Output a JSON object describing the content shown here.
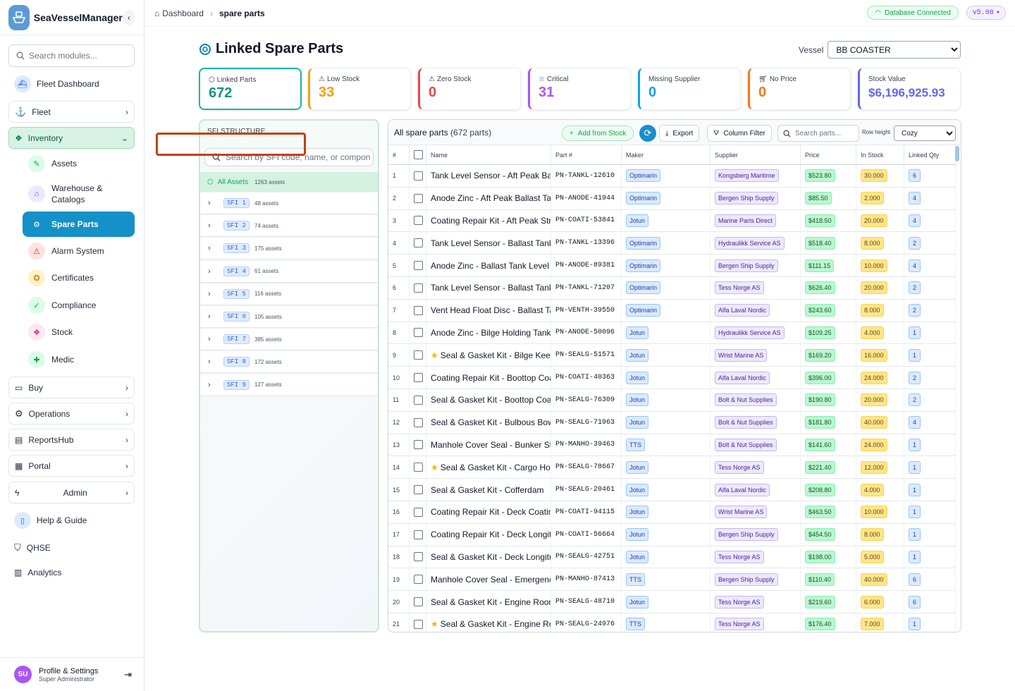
{
  "app": {
    "name": "SeaVesselManager"
  },
  "sidebar": {
    "search_placeholder": "Search modules...",
    "fleet_dashboard": "Fleet Dashboard",
    "fleet": "Fleet",
    "inventory": "Inventory",
    "inventory_items": [
      "Assets",
      "Warehouse & Catalogs",
      "Spare Parts",
      "Alarm System",
      "Certificates",
      "Compliance",
      "Stock",
      "Medic"
    ],
    "buy": "Buy",
    "operations": "Operations",
    "reportshub": "ReportsHub",
    "portal": "Portal",
    "admin": "Admin",
    "help": "Help & Guide",
    "qhse": "QHSE",
    "analytics": "Analytics",
    "profile": {
      "initials": "SU",
      "name": "Profile & Settings",
      "role": "Super Administrator"
    }
  },
  "topbar": {
    "breadcrumb_home": "Dashboard",
    "breadcrumb_current": "spare parts",
    "db_status": "Database Connected",
    "version": "v5.08"
  },
  "header": {
    "title": "Linked Spare Parts",
    "vessel_label": "Vessel",
    "vessel_selected": "BB COASTER"
  },
  "stats": [
    {
      "label": "Linked Parts",
      "value": "672",
      "color": "#14b8a6"
    },
    {
      "label": "Low Stock",
      "value": "33",
      "color": "#f59e0b"
    },
    {
      "label": "Zero Stock",
      "value": "0",
      "color": "#ef4444"
    },
    {
      "label": "Critical",
      "value": "31",
      "color": "#a855f7"
    },
    {
      "label": "Missing Supplier",
      "value": "0",
      "color": "#0ea5e9"
    },
    {
      "label": "No Price",
      "value": "0",
      "color": "#f97316"
    },
    {
      "label": "Stock Value",
      "value": "$6,196,925.93",
      "color": "#6366f1"
    }
  ],
  "sfi": {
    "title": "SFI STRUCTURE",
    "search_placeholder": "Search by SFI code, name, or component",
    "all_label": "All Assets",
    "all_count": "1263 assets",
    "groups": [
      {
        "code": "SFI 1",
        "count": "48 assets"
      },
      {
        "code": "SFI 2",
        "count": "74 assets"
      },
      {
        "code": "SFI 3",
        "count": "175 assets"
      },
      {
        "code": "SFI 4",
        "count": "61 assets"
      },
      {
        "code": "SFI 5",
        "count": "116 assets"
      },
      {
        "code": "SFI 6",
        "count": "105 assets"
      },
      {
        "code": "SFI 7",
        "count": "385 assets"
      },
      {
        "code": "SFI 8",
        "count": "172 assets"
      },
      {
        "code": "SFI 9",
        "count": "127 assets"
      }
    ]
  },
  "table": {
    "heading": "All spare parts",
    "count": "(672 parts)",
    "add_label": "Add from Stock",
    "export_label": "Export",
    "filter_label": "Column Filter",
    "search_placeholder": "Search parts...",
    "row_height_label": "Row height",
    "row_height_value": "Cozy",
    "columns": [
      "#",
      "",
      "Name",
      "Part #",
      "Maker",
      "Supplier",
      "Price",
      "In Stock",
      "Linked Qty"
    ],
    "rows": [
      {
        "n": "1",
        "star": false,
        "name": "Tank Level Sensor - Aft Peak Ballast",
        "part": "PN-TANKL-12610",
        "maker": "Optimarin",
        "supplier": "Kongsberg Maritime",
        "price": "$523.80",
        "stock": "30.000",
        "qty": "6"
      },
      {
        "n": "2",
        "star": false,
        "name": "Anode Zinc - Aft Peak Ballast Tank",
        "part": "PN-ANODE-41944",
        "maker": "Optimarin",
        "supplier": "Bergen Ship Supply",
        "price": "$85.50",
        "stock": "2.000",
        "qty": "4"
      },
      {
        "n": "3",
        "star": false,
        "name": "Coating Repair Kit - Aft Peak Structure",
        "part": "PN-COATI-53841",
        "maker": "Jotun",
        "supplier": "Marine Parts Direct",
        "price": "$418.50",
        "stock": "20.000",
        "qty": "4"
      },
      {
        "n": "4",
        "star": false,
        "name": "Tank Level Sensor - Ballast Tank",
        "part": "PN-TANKL-13396",
        "maker": "Optimarin",
        "supplier": "Hydraulikk Service AS",
        "price": "$518.40",
        "stock": "8.000",
        "qty": "2"
      },
      {
        "n": "5",
        "star": false,
        "name": "Anode Zinc - Ballast Tank Level Sensor",
        "part": "PN-ANODE-89381",
        "maker": "Optimarin",
        "supplier": "Bergen Ship Supply",
        "price": "$111.15",
        "stock": "10.000",
        "qty": "4"
      },
      {
        "n": "6",
        "star": false,
        "name": "Tank Level Sensor - Ballast Tank",
        "part": "PN-TANKL-71207",
        "maker": "Optimarin",
        "supplier": "Tess Norge AS",
        "price": "$626.40",
        "stock": "20.000",
        "qty": "2"
      },
      {
        "n": "7",
        "star": false,
        "name": "Vent Head Float Disc - Ballast Tank",
        "part": "PN-VENTH-39550",
        "maker": "Optimarin",
        "supplier": "Alfa Laval Nordic",
        "price": "$243.60",
        "stock": "8.000",
        "qty": "2"
      },
      {
        "n": "8",
        "star": false,
        "name": "Anode Zinc - Bilge Holding Tank",
        "part": "PN-ANODE-50096",
        "maker": "Jotun",
        "supplier": "Hydraulikk Service AS",
        "price": "$109.25",
        "stock": "4.000",
        "qty": "1"
      },
      {
        "n": "9",
        "star": true,
        "name": "Seal & Gasket Kit - Bilge Keel",
        "part": "PN-SEALG-51571",
        "maker": "Jotun",
        "supplier": "Wrist Marine AS",
        "price": "$169.20",
        "stock": "16.000",
        "qty": "1"
      },
      {
        "n": "10",
        "star": false,
        "name": "Coating Repair Kit - Boottop Coating",
        "part": "PN-COATI-40363",
        "maker": "Jotun",
        "supplier": "Alfa Laval Nordic",
        "price": "$396.00",
        "stock": "24.000",
        "qty": "2"
      },
      {
        "n": "11",
        "star": false,
        "name": "Seal & Gasket Kit - Boottop Coating",
        "part": "PN-SEALG-76309",
        "maker": "Jotun",
        "supplier": "Bolt & Nut Supplies",
        "price": "$190.80",
        "stock": "20.000",
        "qty": "2"
      },
      {
        "n": "12",
        "star": false,
        "name": "Seal & Gasket Kit - Bulbous Bow",
        "part": "PN-SEALG-71963",
        "maker": "Jotun",
        "supplier": "Bolt & Nut Supplies",
        "price": "$181.80",
        "stock": "40.000",
        "qty": "4"
      },
      {
        "n": "13",
        "star": false,
        "name": "Manhole Cover Seal - Bunker Station",
        "part": "PN-MANHO-39463",
        "maker": "TTS",
        "supplier": "Bolt & Nut Supplies",
        "price": "$141.60",
        "stock": "24.000",
        "qty": "1"
      },
      {
        "n": "14",
        "star": true,
        "name": "Seal & Gasket Kit - Cargo Hold",
        "part": "PN-SEALG-78667",
        "maker": "Jotun",
        "supplier": "Tess Norge AS",
        "price": "$221.40",
        "stock": "12.000",
        "qty": "1"
      },
      {
        "n": "15",
        "star": false,
        "name": "Seal & Gasket Kit - Cofferdam",
        "part": "PN-SEALG-20461",
        "maker": "Jotun",
        "supplier": "Alfa Laval Nordic",
        "price": "$208.80",
        "stock": "4.000",
        "qty": "1"
      },
      {
        "n": "16",
        "star": false,
        "name": "Coating Repair Kit - Deck Coating",
        "part": "PN-COATI-94115",
        "maker": "Jotun",
        "supplier": "Wrist Marine AS",
        "price": "$463.50",
        "stock": "10.000",
        "qty": "1"
      },
      {
        "n": "17",
        "star": false,
        "name": "Coating Repair Kit - Deck Longitudinal",
        "part": "PN-COATI-56664",
        "maker": "Jotun",
        "supplier": "Bergen Ship Supply",
        "price": "$454.50",
        "stock": "8.000",
        "qty": "1"
      },
      {
        "n": "18",
        "star": false,
        "name": "Seal & Gasket Kit - Deck Longitudinal",
        "part": "PN-SEALG-42751",
        "maker": "Jotun",
        "supplier": "Tess Norge AS",
        "price": "$198.00",
        "stock": "5.000",
        "qty": "1"
      },
      {
        "n": "19",
        "star": false,
        "name": "Manhole Cover Seal - Emergency",
        "part": "PN-MANHO-87413",
        "maker": "TTS",
        "supplier": "Bergen Ship Supply",
        "price": "$110.40",
        "stock": "40.000",
        "qty": "6"
      },
      {
        "n": "20",
        "star": false,
        "name": "Seal & Gasket Kit - Engine Room",
        "part": "PN-SEALG-48710",
        "maker": "Jotun",
        "supplier": "Tess Norge AS",
        "price": "$219.60",
        "stock": "6.000",
        "qty": "6"
      },
      {
        "n": "21",
        "star": true,
        "name": "Seal & Gasket Kit - Engine Room",
        "part": "PN-SEALG-24976",
        "maker": "TTS",
        "supplier": "Tess Norge AS",
        "price": "$176.40",
        "stock": "7.000",
        "qty": "1"
      }
    ]
  }
}
